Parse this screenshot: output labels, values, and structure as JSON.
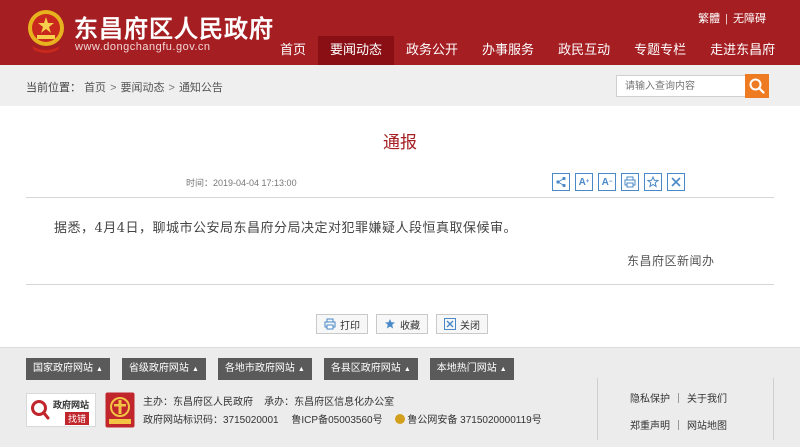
{
  "header": {
    "site_title": "东昌府区人民政府",
    "site_url": "www.dongchangfu.gov.cn",
    "top_links": [
      "繁體",
      "无障碍"
    ],
    "nav": [
      "首页",
      "要闻动态",
      "政务公开",
      "办事服务",
      "政民互动",
      "专题专栏",
      "走进东昌府"
    ],
    "active_nav": "要闻动态",
    "brand_color": "#a41e22"
  },
  "breadcrumb": {
    "label": "当前位置：",
    "items": [
      "首页",
      "要闻动态",
      "通知公告"
    ]
  },
  "search": {
    "placeholder": "请输入查询内容",
    "button_icon": "search-icon"
  },
  "article": {
    "title": "通报",
    "time": "时间：2019-04-04 17:13:00",
    "tools": [
      "share-icon",
      "font-increase-icon",
      "font-decrease-icon",
      "print-icon",
      "favorite-icon",
      "close-icon"
    ],
    "body": "据悉，4月4日，聊城市公安局东昌府分局决定对犯罪嫌疑人段恒真取保候审。",
    "signoff": "东昌府区新闻办"
  },
  "actions": {
    "print": "打印",
    "favorite": "收藏",
    "close": "关闭"
  },
  "footer": {
    "tabs": [
      "国家政府网站",
      "省级政府网站",
      "各地市政府网站",
      "各县区政府网站",
      "本地热门网站"
    ],
    "badge_title": "政府网站",
    "badge_action": "找错",
    "sponsor": "主办：东昌府区人民政府",
    "undertaker": "承办：东昌府区信息化办公室",
    "site_code": "政府网站标识码：3715020001",
    "icp": "鲁ICP备05003560号",
    "police": "鲁公网安备 3715020000119号",
    "links": [
      [
        "隐私保护",
        "关于我们"
      ],
      [
        "郑重声明",
        "网站地图"
      ]
    ]
  }
}
